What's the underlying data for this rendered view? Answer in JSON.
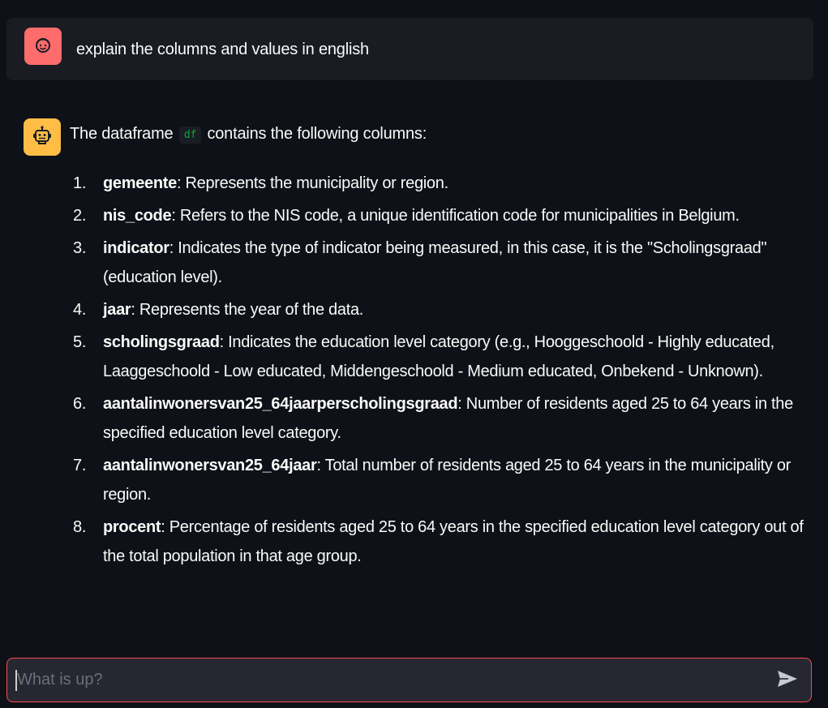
{
  "colors": {
    "background": "#0e1117",
    "user_message_bg": "#1a1c24",
    "user_avatar": "#ff6c6c",
    "bot_avatar": "#ffbd45",
    "input_border": "#ff4b4b",
    "input_bg": "#262730",
    "code_text": "#09ab3b"
  },
  "user_message": {
    "avatar_icon": "face-icon",
    "text": "explain the columns and values in english"
  },
  "assistant_message": {
    "avatar_icon": "robot-icon",
    "intro_before": "The dataframe",
    "intro_code": "df",
    "intro_after": "contains the following columns:",
    "columns": [
      {
        "number": "1.",
        "name": "gemeente",
        "description": ": Represents the municipality or region."
      },
      {
        "number": "2.",
        "name": "nis_code",
        "description": ": Refers to the NIS code, a unique identification code for municipalities in Belgium."
      },
      {
        "number": "3.",
        "name": "indicator",
        "description": ": Indicates the type of indicator being measured, in this case, it is the \"Scholingsgraad\" (education level)."
      },
      {
        "number": "4.",
        "name": "jaar",
        "description": ": Represents the year of the data."
      },
      {
        "number": "5.",
        "name": "scholingsgraad",
        "description": ": Indicates the education level category (e.g., Hooggeschoold - Highly educated, Laaggeschoold - Low educated, Middengeschoold - Medium educated, Onbekend - Unknown)."
      },
      {
        "number": "6.",
        "name": "aantalinwonersvan25_64jaarperscholingsgraad",
        "description": ": Number of residents aged 25 to 64 years in the specified education level category."
      },
      {
        "number": "7.",
        "name": "aantalinwonersvan25_64jaar",
        "description": ": Total number of residents aged 25 to 64 years in the municipality or region."
      },
      {
        "number": "8.",
        "name": "procent",
        "description": ": Percentage of residents aged 25 to 64 years in the specified education level category out of the total population in that age group."
      }
    ]
  },
  "chat_input": {
    "placeholder": "What is up?",
    "value": "",
    "send_icon": "send-icon"
  }
}
